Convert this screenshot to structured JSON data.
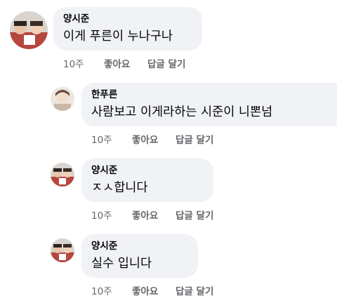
{
  "comments": [
    {
      "author": "양시준",
      "text": "이게 푸른이 누나구나",
      "time": "10주",
      "like_label": "좋아요",
      "reply_label": "답글 달기"
    },
    {
      "author": "한푸른",
      "text": "사람보고 이게라하는 시준이 니뽄넘",
      "time": "10주",
      "like_label": "좋아요",
      "reply_label": "답글 달기"
    },
    {
      "author": "양시준",
      "text": "ㅈㅅ합니다",
      "time": "10주",
      "like_label": "좋아요",
      "reply_label": "답글 달기"
    },
    {
      "author": "양시준",
      "text": "실수 입니다",
      "time": "10주",
      "like_label": "좋아요",
      "reply_label": "답글 달기"
    }
  ]
}
